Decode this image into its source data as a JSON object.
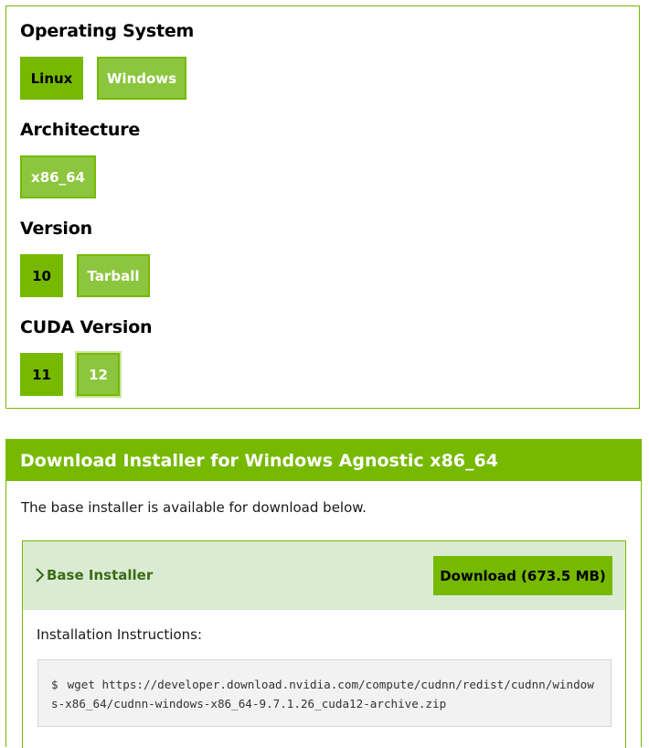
{
  "selector": {
    "os": {
      "title": "Operating System",
      "options": [
        "Linux",
        "Windows"
      ]
    },
    "architecture": {
      "title": "Architecture",
      "options": [
        "x86_64"
      ]
    },
    "version": {
      "title": "Version",
      "options": [
        "10",
        "Tarball"
      ]
    },
    "cuda": {
      "title": "CUDA Version",
      "options": [
        "11",
        "12"
      ]
    }
  },
  "download": {
    "header": "Download Installer for Windows Agnostic x86_64",
    "description": "The base installer is available for download below.",
    "installer_label": "Base Installer",
    "button_label": "Download (673.5 MB)",
    "instructions_label": "Installation Instructions:",
    "prompt": "$",
    "command": "wget https://developer.download.nvidia.com/compute/cudnn/redist/cudnn/windows-x86_64/cudnn-windows-x86_64-9.7.1.26_cuda12-archive.zip"
  },
  "colors": {
    "accent": "#76b900",
    "inactive": "#8cc63e",
    "installer_head_bg": "#d9ecd3",
    "installer_label": "#3c6b14"
  },
  "icons": {
    "installer_toggle": "chevron-right-icon"
  }
}
